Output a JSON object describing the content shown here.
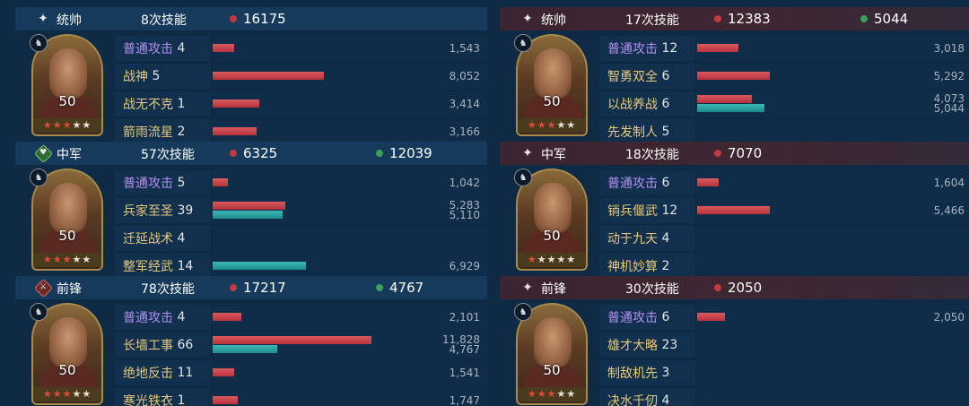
{
  "left_team": [
    {
      "role": "统帅",
      "skill_count": "8次技能",
      "damage": "16175",
      "heal": null,
      "level": "50",
      "stars_red": 3,
      "stars_total": 5,
      "skills": [
        {
          "name": "普通攻击",
          "count": "4",
          "color": "purple",
          "dmg": "1,543",
          "heal": null,
          "dmg_frac": 0.079,
          "heal_frac": 0
        },
        {
          "name": "战神",
          "count": "5",
          "color": "gold",
          "dmg": "8,052",
          "heal": null,
          "dmg_frac": 0.405,
          "heal_frac": 0
        },
        {
          "name": "战无不克",
          "count": "1",
          "color": "gold",
          "dmg": "3,414",
          "heal": null,
          "dmg_frac": 0.17,
          "heal_frac": 0
        },
        {
          "name": "箭雨流星",
          "count": "2",
          "color": "gold",
          "dmg": "3,166",
          "heal": null,
          "dmg_frac": 0.16,
          "heal_frac": 0
        }
      ]
    },
    {
      "role": "中军",
      "skill_count": "57次技能",
      "damage": "6325",
      "heal": "12039",
      "level": "50",
      "stars_red": 3,
      "stars_total": 5,
      "skills": [
        {
          "name": "普通攻击",
          "count": "5",
          "color": "purple",
          "dmg": "1,042",
          "heal": null,
          "dmg_frac": 0.055,
          "heal_frac": 0
        },
        {
          "name": "兵家至圣",
          "count": "39",
          "color": "gold",
          "dmg": "5,283",
          "heal": "5,110",
          "dmg_frac": 0.265,
          "heal_frac": 0.255
        },
        {
          "name": "迁延战术",
          "count": "4",
          "color": "gold",
          "dmg": null,
          "heal": null,
          "dmg_frac": 0,
          "heal_frac": 0
        },
        {
          "name": "整军经武",
          "count": "14",
          "color": "gold",
          "dmg": null,
          "heal": "6,929",
          "dmg_frac": 0,
          "heal_frac": 0.34
        }
      ]
    },
    {
      "role": "前锋",
      "skill_count": "78次技能",
      "damage": "17217",
      "heal": "4767",
      "level": "50",
      "stars_red": 3,
      "stars_total": 5,
      "skills": [
        {
          "name": "普通攻击",
          "count": "4",
          "color": "purple",
          "dmg": "2,101",
          "heal": null,
          "dmg_frac": 0.105,
          "heal_frac": 0
        },
        {
          "name": "长墙工事",
          "count": "66",
          "color": "gold",
          "dmg": "11,828",
          "heal": "4,767",
          "dmg_frac": 0.58,
          "heal_frac": 0.235
        },
        {
          "name": "绝地反击",
          "count": "11",
          "color": "gold",
          "dmg": "1,541",
          "heal": null,
          "dmg_frac": 0.08,
          "heal_frac": 0
        },
        {
          "name": "寒光铁衣",
          "count": "1",
          "color": "gold",
          "dmg": "1,747",
          "heal": null,
          "dmg_frac": 0.09,
          "heal_frac": 0
        }
      ]
    }
  ],
  "right_team": [
    {
      "role": "统帅",
      "skill_count": "17次技能",
      "damage": "12383",
      "heal": "5044",
      "level": "50",
      "stars_red": 3,
      "stars_total": 5,
      "skills": [
        {
          "name": "普通攻击",
          "count": "12",
          "color": "purple",
          "dmg": "3,018",
          "heal": null,
          "dmg_frac": 0.15,
          "heal_frac": 0
        },
        {
          "name": "智勇双全",
          "count": "6",
          "color": "gold",
          "dmg": "5,292",
          "heal": null,
          "dmg_frac": 0.265,
          "heal_frac": 0
        },
        {
          "name": "以战养战",
          "count": "6",
          "color": "gold",
          "dmg": "4,073",
          "heal": "5,044",
          "dmg_frac": 0.2,
          "heal_frac": 0.245
        },
        {
          "name": "先发制人",
          "count": "5",
          "color": "gold",
          "dmg": null,
          "heal": null,
          "dmg_frac": 0,
          "heal_frac": 0
        }
      ]
    },
    {
      "role": "中军",
      "skill_count": "18次技能",
      "damage": "7070",
      "heal": null,
      "level": "50",
      "stars_red": 1,
      "stars_total": 5,
      "skills": [
        {
          "name": "普通攻击",
          "count": "6",
          "color": "purple",
          "dmg": "1,604",
          "heal": null,
          "dmg_frac": 0.08,
          "heal_frac": 0
        },
        {
          "name": "销兵偃武",
          "count": "12",
          "color": "gold",
          "dmg": "5,466",
          "heal": null,
          "dmg_frac": 0.265,
          "heal_frac": 0
        },
        {
          "name": "动于九天",
          "count": "4",
          "color": "gold",
          "dmg": null,
          "heal": null,
          "dmg_frac": 0,
          "heal_frac": 0
        },
        {
          "name": "神机妙算",
          "count": "2",
          "color": "gold",
          "dmg": null,
          "heal": null,
          "dmg_frac": 0,
          "heal_frac": 0
        }
      ]
    },
    {
      "role": "前锋",
      "skill_count": "30次技能",
      "damage": "2050",
      "heal": null,
      "level": "50",
      "stars_red": 3,
      "stars_total": 5,
      "skills": [
        {
          "name": "普通攻击",
          "count": "6",
          "color": "purple",
          "dmg": "2,050",
          "heal": null,
          "dmg_frac": 0.1,
          "heal_frac": 0
        },
        {
          "name": "雄才大略",
          "count": "23",
          "color": "gold",
          "dmg": null,
          "heal": null,
          "dmg_frac": 0,
          "heal_frac": 0
        },
        {
          "name": "制敌机先",
          "count": "3",
          "color": "gold",
          "dmg": null,
          "heal": null,
          "dmg_frac": 0,
          "heal_frac": 0
        },
        {
          "name": "决水千仞",
          "count": "4",
          "color": "gold",
          "dmg": null,
          "heal": null,
          "dmg_frac": 0,
          "heal_frac": 0
        }
      ]
    }
  ],
  "colors": {
    "damage": "#c03a3e",
    "heal": "#2a9e9a",
    "skill_name_normal": "#b38ff0",
    "skill_name_tactic": "#e8c87a",
    "left_header": "#153a5b",
    "right_header": "#3e2632"
  },
  "icons": {
    "统帅": "commander-star-icon",
    "中军": "center-heart-badge-icon",
    "前锋": "vanguard-sword-badge-icon"
  }
}
